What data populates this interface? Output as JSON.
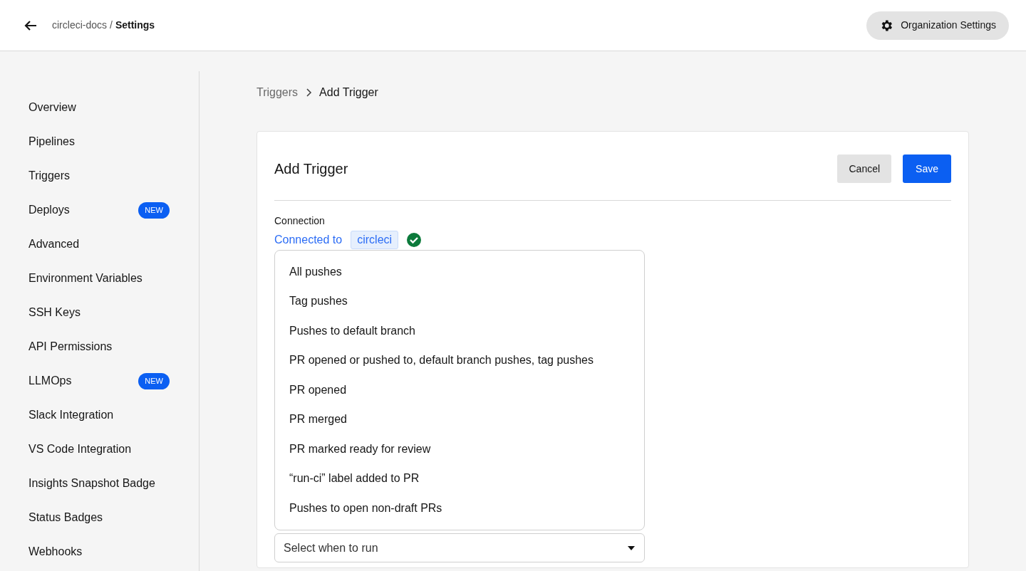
{
  "header": {
    "org": "circleci-docs",
    "separator": "/",
    "page": "Settings",
    "org_settings_button": "Organization Settings"
  },
  "sidebar": {
    "items": [
      {
        "label": "Overview"
      },
      {
        "label": "Pipelines"
      },
      {
        "label": "Triggers"
      },
      {
        "label": "Deploys",
        "badge": "NEW"
      },
      {
        "label": "Advanced"
      },
      {
        "label": "Environment Variables"
      },
      {
        "label": "SSH Keys"
      },
      {
        "label": "API Permissions"
      },
      {
        "label": "LLMOps",
        "badge": "NEW"
      },
      {
        "label": "Slack Integration"
      },
      {
        "label": "VS Code Integration"
      },
      {
        "label": "Insights Snapshot Badge"
      },
      {
        "label": "Status Badges"
      },
      {
        "label": "Webhooks"
      }
    ]
  },
  "breadcrumb": {
    "parent": "Triggers",
    "current": "Add Trigger"
  },
  "card": {
    "title": "Add Trigger",
    "cancel": "Cancel",
    "save": "Save",
    "connection": {
      "label": "Connection",
      "text": "Connected to",
      "repo": "circleci",
      "connected": true
    },
    "dropdown": {
      "expanded": true,
      "options": [
        "All pushes",
        "Tag pushes",
        "Pushes to default branch",
        "PR opened or pushed to, default branch pushes, tag pushes",
        "PR opened",
        "PR merged",
        "PR marked ready for review",
        "“run-ci” label added to PR",
        "Pushes to open non-draft PRs"
      ]
    },
    "select": {
      "placeholder": "Select when to run"
    }
  }
}
